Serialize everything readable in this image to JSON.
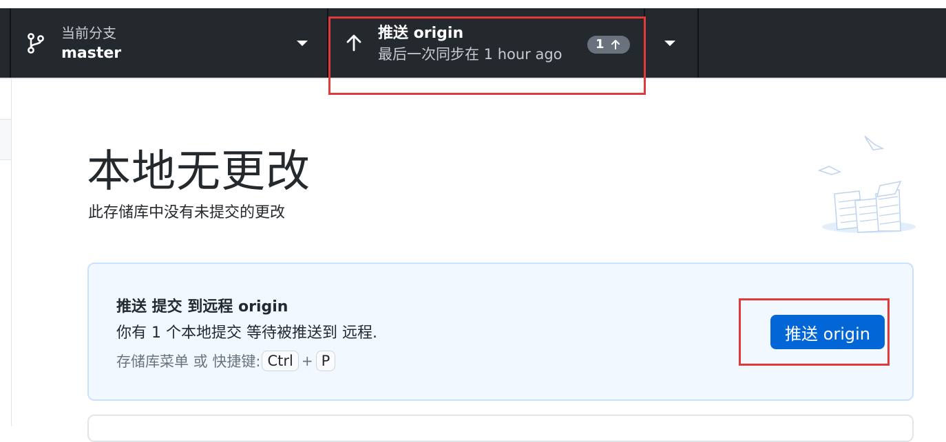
{
  "toolbar": {
    "branch": {
      "label": "当前分支",
      "value": "master"
    },
    "push": {
      "title": "推送 origin",
      "subtitle": "最后一次同步在 1 hour ago",
      "ahead_count": "1"
    }
  },
  "main": {
    "title": "本地无更改",
    "subtitle": "此存储库中没有未提交的更改",
    "push_card": {
      "title": "推送 提交 到远程 origin",
      "description": "你有 1 个本地提交 等待被推送到 远程.",
      "hint_prefix": "存储库菜单 或 快捷键:",
      "shortcut_key1": "Ctrl",
      "shortcut_plus": "+",
      "shortcut_key2": "P",
      "button_label": "推送 origin"
    }
  },
  "colors": {
    "toolbar_bg": "#24292e",
    "accent": "#0366d6",
    "card_bg": "#f1f8ff",
    "highlight": "#e03a3a"
  },
  "icons": {
    "branch": "git-branch-icon",
    "push": "arrow-up-icon",
    "dropdown": "caret-down-icon"
  }
}
